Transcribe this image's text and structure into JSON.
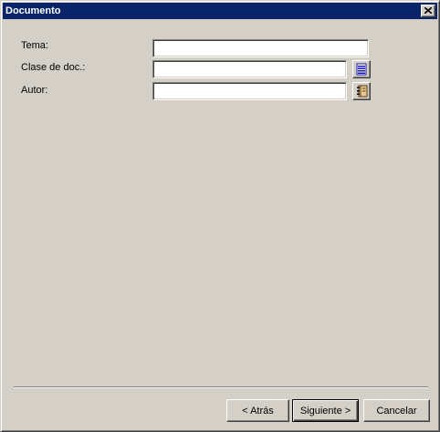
{
  "window": {
    "title": "Documento"
  },
  "form": {
    "tema": {
      "label": "Tema:",
      "value": ""
    },
    "clase": {
      "label": "Clase de doc.:",
      "value": ""
    },
    "autor": {
      "label": "Autor:",
      "value": ""
    }
  },
  "icons": {
    "close": "close-icon",
    "clase_picker": "list-icon",
    "autor_picker": "address-book-icon"
  },
  "buttons": {
    "back": "< Atrás",
    "next": "Siguiente >",
    "cancel": "Cancelar"
  },
  "colors": {
    "titlebar": "#0a246a",
    "dialog_face": "#d4d0c8",
    "list_icon": "#1a1ab4"
  }
}
